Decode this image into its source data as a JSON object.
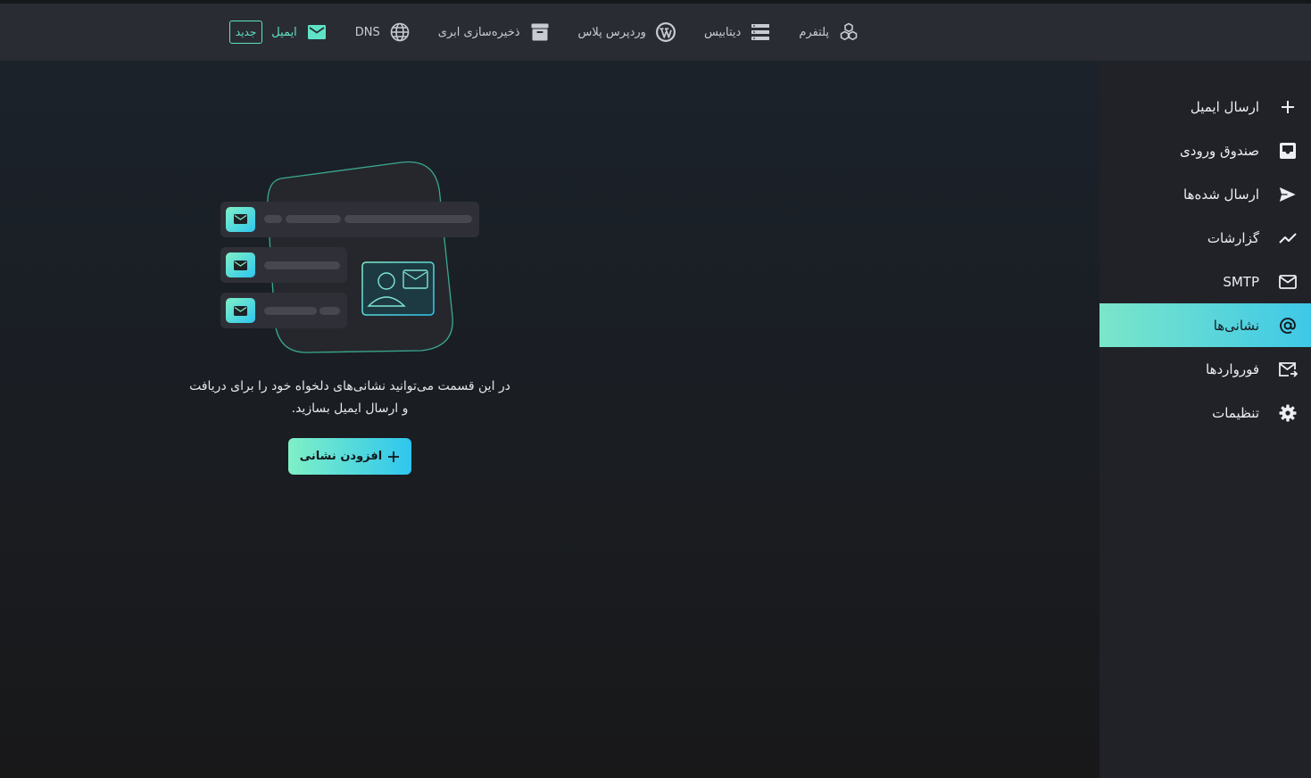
{
  "topbar": {
    "items": [
      {
        "label": "پلتفرم",
        "icon": "cubes-icon"
      },
      {
        "label": "دیتابیس",
        "icon": "database-icon"
      },
      {
        "label": "وردپرس پلاس",
        "icon": "wordpress-icon"
      },
      {
        "label": "ذخیره‌سازی ابری",
        "icon": "archive-icon"
      },
      {
        "label": "DNS",
        "icon": "globe-icon"
      },
      {
        "label": "ایمیل",
        "icon": "mail-icon",
        "active": true
      }
    ],
    "new_badge": "جدید"
  },
  "sidebar": {
    "items": [
      {
        "label": "ارسال ایمیل",
        "icon": "plus-icon"
      },
      {
        "label": "صندوق ورودی",
        "icon": "inbox-icon"
      },
      {
        "label": "ارسال شده‌ها",
        "icon": "send-icon"
      },
      {
        "label": "گزارشات",
        "icon": "chart-line-icon"
      },
      {
        "label": "SMTP",
        "icon": "envelope-icon"
      },
      {
        "label": "نشانی‌ها",
        "icon": "at-icon",
        "active": true
      },
      {
        "label": "فورواردها",
        "icon": "forward-mail-icon"
      },
      {
        "label": "تنظیمات",
        "icon": "gear-icon"
      }
    ]
  },
  "empty_state": {
    "message": "در این قسمت می‌توانید نشانی‌های دلخواه خود را برای دریافت و ارسال ایمیل بسازید.",
    "button_label": "افزودن نشانی"
  },
  "colors": {
    "accent": "#5fe3c7",
    "accent_gradient_start": "#7be6c9",
    "accent_gradient_end": "#3ec8e8",
    "topbar_bg": "#2a2c33",
    "sidebar_bg": "#212228"
  }
}
